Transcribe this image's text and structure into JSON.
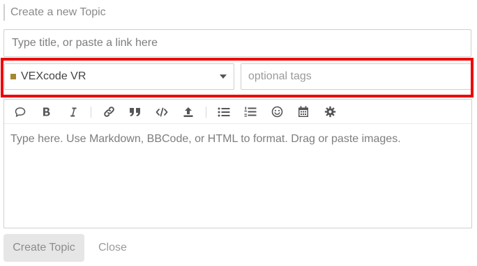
{
  "composer": {
    "header": "Create a new Topic",
    "title_placeholder": "Type title, or paste a link here",
    "category": {
      "label": "VEXcode VR",
      "color": "#a6862f"
    },
    "tags_placeholder": "optional tags",
    "toolbar": [
      "quote-icon",
      "bold-icon",
      "italic-icon",
      "link-icon",
      "blockquote-icon",
      "code-icon",
      "upload-icon",
      "bullet-list-icon",
      "numbered-list-icon",
      "emoji-icon",
      "calendar-icon",
      "gear-icon"
    ],
    "editor_placeholder": "Type here. Use Markdown, BBCode, or HTML to format. Drag or paste images.",
    "create_label": "Create Topic",
    "close_label": "Close"
  },
  "annotation": {
    "highlight_color": "#ee0000"
  }
}
